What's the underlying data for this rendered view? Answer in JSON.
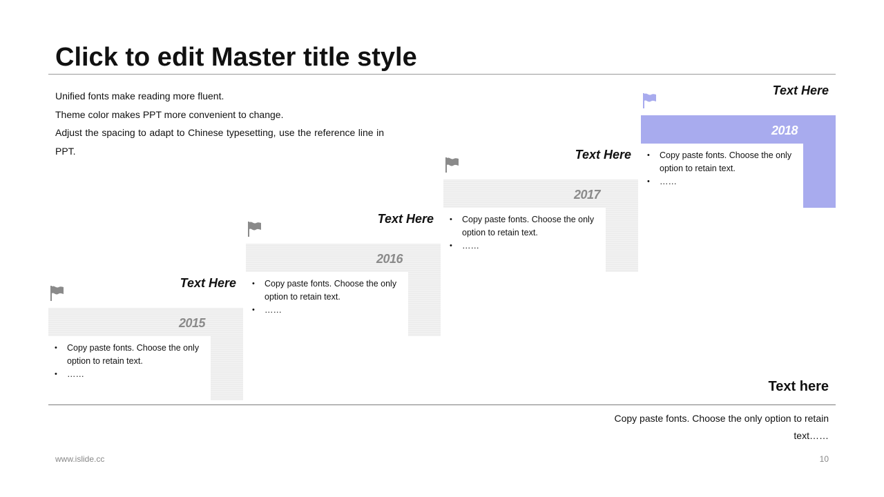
{
  "title": "Click to edit Master title style",
  "intro": [
    "Unified fonts make reading more fluent.",
    "Theme color makes PPT more convenient to change.",
    "Adjust the spacing to adapt to Chinese typesetting, use the reference line in PPT."
  ],
  "steps": [
    {
      "heading": "Text Here",
      "year": "2015",
      "icon": "flag-icon",
      "bullets": [
        "Copy paste fonts. Choose the only option to retain text.",
        "……"
      ]
    },
    {
      "heading": "Text Here",
      "year": "2016",
      "icon": "flag-icon",
      "bullets": [
        "Copy paste fonts. Choose the only option to retain text.",
        "……"
      ]
    },
    {
      "heading": "Text Here",
      "year": "2017",
      "icon": "flag-icon",
      "bullets": [
        "Copy paste fonts. Choose the only option to retain text.",
        "……"
      ]
    },
    {
      "heading": "Text Here",
      "year": "2018",
      "icon": "flag-icon",
      "bullets": [
        "Copy paste fonts. Choose the only option to retain text.",
        "……"
      ]
    }
  ],
  "summary": {
    "title": "Text here",
    "text": "Copy paste fonts. Choose the only option to retain text……"
  },
  "footer": {
    "website": "www.islide.cc",
    "page_number": "10"
  },
  "colors": {
    "accent": "#a8abee",
    "neutral_panel": "#ededed",
    "neutral_text": "#8a8a8a"
  }
}
